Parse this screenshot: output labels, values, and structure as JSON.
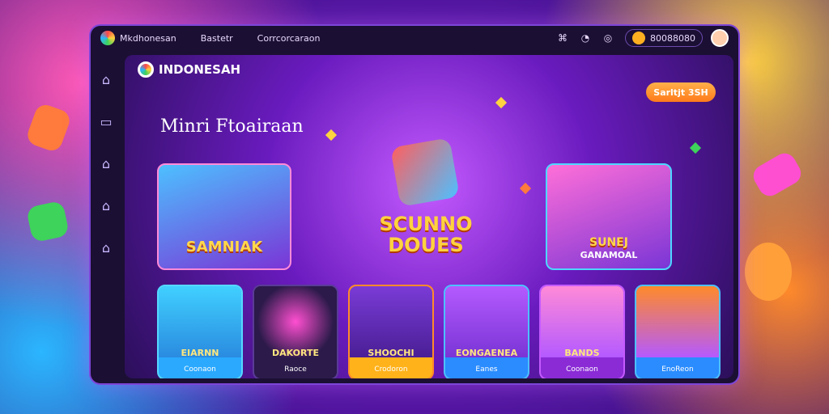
{
  "window": {
    "top_links": [
      "Mkdhonesan",
      "Bastetr",
      "Corrcorcaraon"
    ],
    "coins": "80088080"
  },
  "content": {
    "brand": "INDONESAH",
    "title": "Minri Ftoairaan",
    "cta": "Sarltjt 3SH",
    "heroes": [
      {
        "title": "SAMNIAK",
        "sub": ""
      },
      {
        "title": "SUNEJ",
        "sub": "GANAMOAL"
      }
    ],
    "center_text": [
      "SCUNNO",
      "DOUES"
    ],
    "tiles": [
      {
        "label": "EIARNN",
        "sub": "Coonaon"
      },
      {
        "label": "DAKORTE",
        "sub": "Raoce"
      },
      {
        "label": "SHOOCHI",
        "sub": "Crodoron"
      },
      {
        "label": "EONGAENEA",
        "sub": "Eanes"
      },
      {
        "label": "BANDS",
        "sub": "Coonaon"
      },
      {
        "label": "",
        "sub": "EnoReon"
      }
    ]
  }
}
